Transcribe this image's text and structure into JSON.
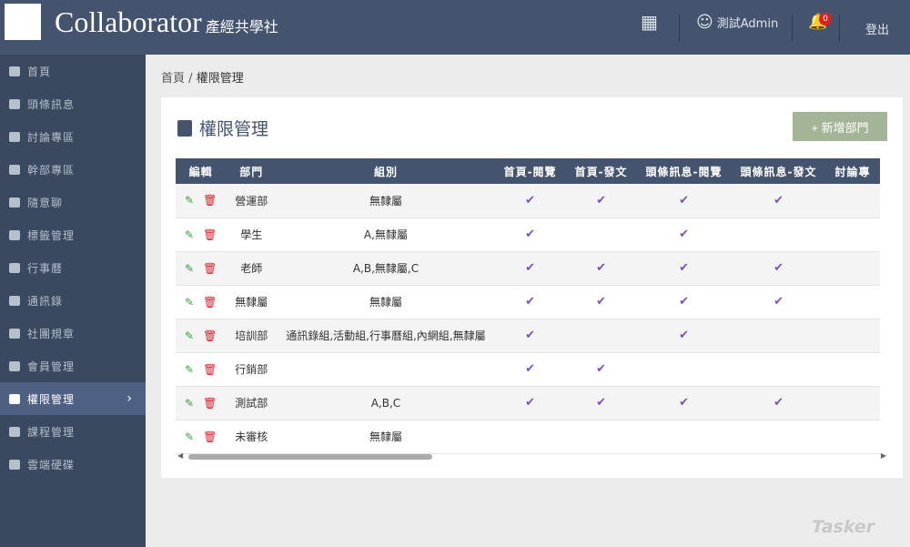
{
  "header": {
    "brand": "Collaborator",
    "brand_sub": "產經共學社",
    "user": "測試Admin",
    "notifications": "0",
    "logout": "登出"
  },
  "sidebar": {
    "items": [
      {
        "label": "首頁",
        "icon": "home-icon"
      },
      {
        "label": "頭條訊息",
        "icon": "message-icon"
      },
      {
        "label": "討論專區",
        "icon": "forum-icon"
      },
      {
        "label": "幹部專區",
        "icon": "badge-icon"
      },
      {
        "label": "隨意聊",
        "icon": "chat-icon"
      },
      {
        "label": "標籤管理",
        "icon": "calendar-icon"
      },
      {
        "label": "行事曆",
        "icon": "calendar-icon"
      },
      {
        "label": "通訊錄",
        "icon": "contact-icon"
      },
      {
        "label": "社團規章",
        "icon": "star-icon"
      },
      {
        "label": "會員管理",
        "icon": "folder-user-icon"
      },
      {
        "label": "權限管理",
        "icon": "badge-icon",
        "active": true
      },
      {
        "label": "課程管理",
        "icon": "folder-user-icon"
      },
      {
        "label": "雲端硬碟",
        "icon": "star-icon"
      }
    ]
  },
  "breadcrumb": {
    "home": "首頁",
    "sep": "/",
    "current": "權限管理"
  },
  "page": {
    "title": "權限管理",
    "add_button": "+ 新增部門"
  },
  "table": {
    "headers": [
      "編輯",
      "部門",
      "組別",
      "首頁-閱覽",
      "首頁-發文",
      "頭條訊息-閱覽",
      "頭條訊息-發文",
      "討論專"
    ],
    "rows": [
      {
        "dept": "營運部",
        "group": "無隸屬",
        "perms": [
          true,
          true,
          true,
          true
        ]
      },
      {
        "dept": "學生",
        "group": "A,無隸屬",
        "perms": [
          true,
          false,
          true,
          false
        ]
      },
      {
        "dept": "老師",
        "group": "A,B,無隸屬,C",
        "perms": [
          true,
          true,
          true,
          true
        ]
      },
      {
        "dept": "無隸屬",
        "group": "無隸屬",
        "perms": [
          true,
          true,
          true,
          true
        ]
      },
      {
        "dept": "培訓部",
        "group": "通訊錄組,活動組,行事曆組,內網組,無隸屬",
        "perms": [
          true,
          false,
          true,
          false
        ]
      },
      {
        "dept": "行銷部",
        "group": "",
        "perms": [
          true,
          true,
          false,
          false
        ]
      },
      {
        "dept": "測試部",
        "group": "A,B,C",
        "perms": [
          true,
          true,
          true,
          true
        ]
      },
      {
        "dept": "未審核",
        "group": "無隸屬",
        "perms": [
          false,
          false,
          false,
          false
        ]
      }
    ]
  },
  "watermark": "Tasker",
  "colors": {
    "header": "#44546f",
    "sidebar": "#3a4860",
    "check": "#7a52c0",
    "add_button": "#a3b596"
  }
}
